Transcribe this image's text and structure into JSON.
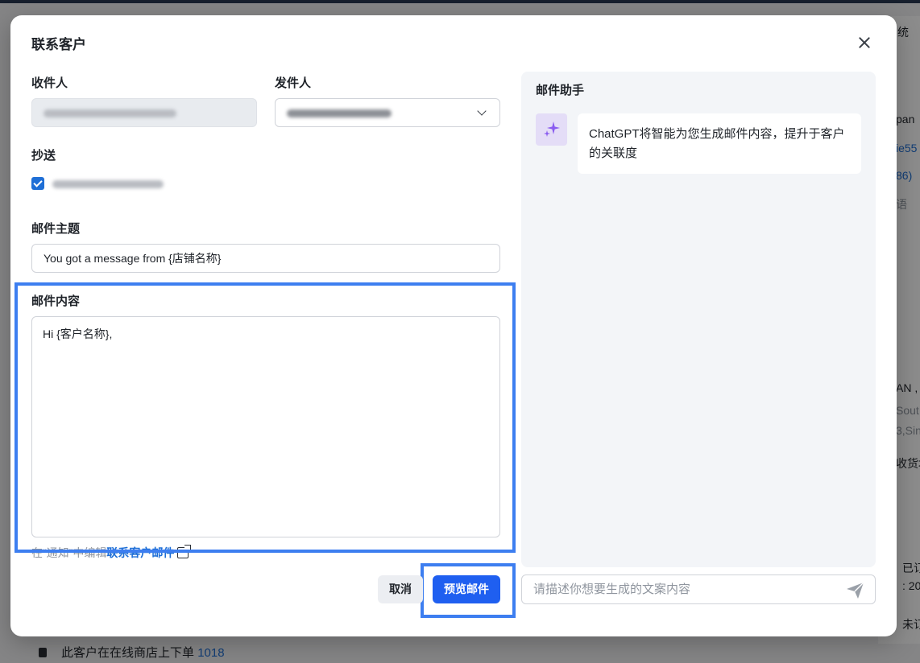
{
  "background": {
    "right_column": [
      "统",
      "pan",
      "ie55",
      "86)",
      "语",
      "AN ,",
      "Sout",
      "3,Sin",
      "收货地",
      "已订",
      ": 20",
      "未订"
    ],
    "bottom_row": {
      "text": "此客户在在线商店上下单",
      "count": "1018"
    }
  },
  "modal": {
    "title": "联系客户",
    "close_icon": "close-icon",
    "recipient": {
      "label": "收件人",
      "value": ""
    },
    "sender": {
      "label": "发件人",
      "value": "",
      "icon": "chevron-down-icon"
    },
    "cc": {
      "label": "抄送",
      "checked": true,
      "value": ""
    },
    "subject": {
      "label": "邮件主题",
      "value": "You got a message from {店铺名称}"
    },
    "body": {
      "label": "邮件内容",
      "value": "Hi {客户名称},"
    },
    "hint": {
      "prefix": "在“通知”中编辑",
      "link": "联系客户邮件",
      "icon": "external-link-icon"
    },
    "buttons": {
      "cancel": "取消",
      "preview": "预览邮件"
    }
  },
  "assistant": {
    "title": "邮件助手",
    "avatar_icon": "sparkle-icon",
    "message": "ChatGPT将智能为您生成邮件内容，提升于客户的关联度",
    "input_placeholder": "请描述你想要生成的文案内容",
    "send_icon": "send-icon"
  },
  "colors": {
    "primary": "#1f5ff0",
    "highlight": "#3d7ef0",
    "link": "#1f6fd6",
    "ai_accent": "#8a5cf0"
  }
}
